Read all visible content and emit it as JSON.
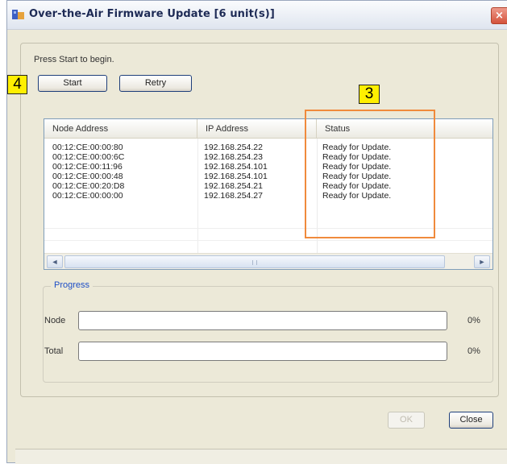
{
  "window": {
    "title": "Over-the-Air Firmware Update [6 unit(s)]",
    "close_glyph": "×"
  },
  "main": {
    "hint": "Press Start to begin.",
    "start_label": "Start",
    "retry_label": "Retry"
  },
  "annotations": {
    "badge_start": "4",
    "badge_status": "3",
    "highlight_color": "#f08a3c",
    "badge_color": "#ffef00"
  },
  "table": {
    "columns": [
      "Node Address",
      "IP Address",
      "Status"
    ],
    "rows": [
      [
        "00:12:CE:00:00:80",
        "192.168.254.22",
        "Ready for Update."
      ],
      [
        "00:12:CE:00:00:6C",
        "192.168.254.23",
        "Ready for Update."
      ],
      [
        "00:12:CE:00:11:96",
        "192.168.254.101",
        "Ready for Update."
      ],
      [
        "00:12:CE:00:00:48",
        "192.168.254.101",
        "Ready for Update."
      ],
      [
        "00:12:CE:00:20:D8",
        "192.168.254.21",
        "Ready for Update."
      ],
      [
        "00:12:CE:00:00:00",
        "192.168.254.27",
        "Ready for Update."
      ]
    ],
    "scroll_left_glyph": "◄",
    "scroll_right_glyph": "►"
  },
  "progress": {
    "legend": "Progress",
    "node_label": "Node",
    "node_pct": "0%",
    "node_value": 0,
    "total_label": "Total",
    "total_pct": "0%",
    "total_value": 0
  },
  "footer": {
    "ok_label": "OK",
    "close_label": "Close"
  }
}
